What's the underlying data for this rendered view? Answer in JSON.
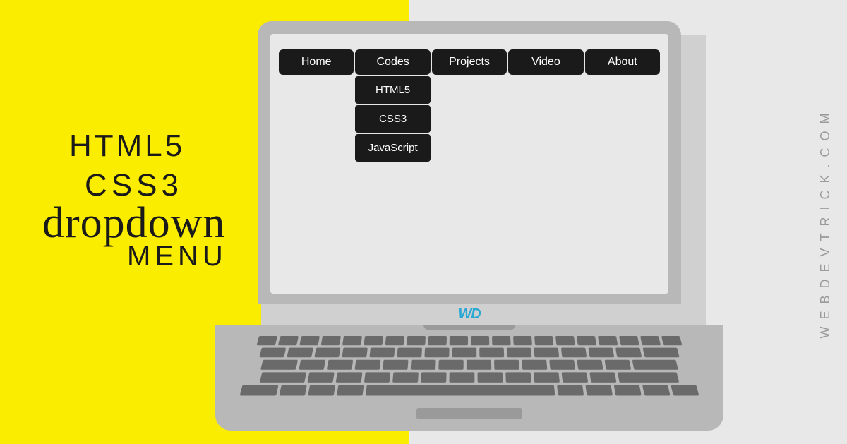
{
  "title": {
    "line1": "HTML5",
    "line2": "CSS3",
    "drop": "dropdown",
    "menu": "MENU"
  },
  "nav": {
    "items": [
      {
        "label": "Home"
      },
      {
        "label": "Codes"
      },
      {
        "label": "Projects"
      },
      {
        "label": "Video"
      },
      {
        "label": "About"
      }
    ],
    "dropdown": [
      {
        "label": "HTML5"
      },
      {
        "label": "CSS3"
      },
      {
        "label": "JavaScript"
      }
    ]
  },
  "logo": "WD",
  "watermark": "WEBDEVTRICK.COM"
}
